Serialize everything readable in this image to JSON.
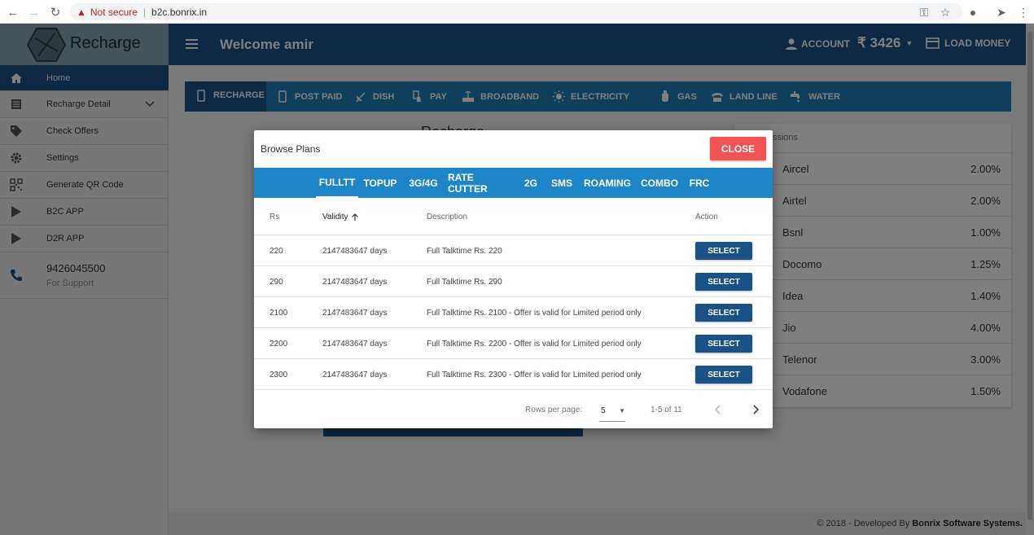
{
  "browser": {
    "security_text": "Not secure",
    "url": "b2c.bonrix.in"
  },
  "sidebar": {
    "logo_text": "Recharge",
    "items": [
      {
        "label": "Home",
        "icon": "home-icon"
      },
      {
        "label": "Recharge Detail",
        "icon": "list-icon"
      },
      {
        "label": "Check Offers",
        "icon": "tag-icon"
      },
      {
        "label": "Settings",
        "icon": "gear-icon"
      },
      {
        "label": "Generate QR Code",
        "icon": "qr-code-icon"
      },
      {
        "label": "B2C APP",
        "icon": "play-store-icon"
      },
      {
        "label": "D2R APP",
        "icon": "play-store-icon"
      }
    ],
    "support_phone": "9426045500",
    "support_label": "For Support"
  },
  "topbar": {
    "welcome": "Welcome amir",
    "account_label": "ACCOUNT",
    "balance": "₹ 3426",
    "load_money_label": "LOAD MONEY"
  },
  "services": [
    {
      "label": "RECHARGE"
    },
    {
      "label": "POST PAID"
    },
    {
      "label": "DISH"
    },
    {
      "label": "PAY"
    },
    {
      "label": "BROADBAND"
    },
    {
      "label": "ELECTRICITY"
    },
    {
      "label": "GAS"
    },
    {
      "label": "LAND LINE"
    },
    {
      "label": "WATER"
    }
  ],
  "main": {
    "recharge_title": "Recharge",
    "commission_head": "Commissions",
    "commissions": [
      {
        "operator": "Aircel",
        "percent": "2.00%"
      },
      {
        "operator": "Airtel",
        "percent": "2.00%"
      },
      {
        "operator": "Bsnl",
        "percent": "1.00%"
      },
      {
        "operator": "Docomo",
        "percent": "1.25%"
      },
      {
        "operator": "Idea",
        "percent": "1.40%"
      },
      {
        "operator": "Jio",
        "percent": "4.00%"
      },
      {
        "operator": "Telenor",
        "percent": "3.00%"
      },
      {
        "operator": "Vodafone",
        "percent": "1.50%"
      }
    ]
  },
  "modal": {
    "title": "Browse Plans",
    "close_label": "CLOSE",
    "tabs": [
      "FULLTT",
      "TOPUP",
      "3G/4G",
      "RATE CUTTER",
      "2G",
      "SMS",
      "ROAMING",
      "COMBO",
      "FRC"
    ],
    "columns": {
      "rs": "Rs",
      "validity": "Validity",
      "description": "Description",
      "action": "Action"
    },
    "rows": [
      {
        "rs": "220",
        "validity": "2147483647 days",
        "description": "Full Talktime Rs. 220"
      },
      {
        "rs": "290",
        "validity": "2147483647 days",
        "description": "Full Talktime Rs. 290"
      },
      {
        "rs": "2100",
        "validity": "2147483647 days",
        "description": "Full Talktime Rs. 2100 - Offer is valid for Limited period only"
      },
      {
        "rs": "2200",
        "validity": "2147483647 days",
        "description": "Full Talktime Rs. 2200 - Offer is valid for Limited period only"
      },
      {
        "rs": "2300",
        "validity": "2147483647 days",
        "description": "Full Talktime Rs. 2300 - Offer is valid for Limited period only"
      }
    ],
    "select_label": "SELECT",
    "rows_per_page_label": "Rows per page:",
    "rows_per_page": "5",
    "range": "1-5 of 11"
  },
  "footer": {
    "text": "© 2018 - Developed By",
    "company": "Bonrix Software Systems."
  },
  "colors": {
    "primary": "#1a5288",
    "tab_bar": "#1e85c8",
    "close": "#f25355"
  }
}
